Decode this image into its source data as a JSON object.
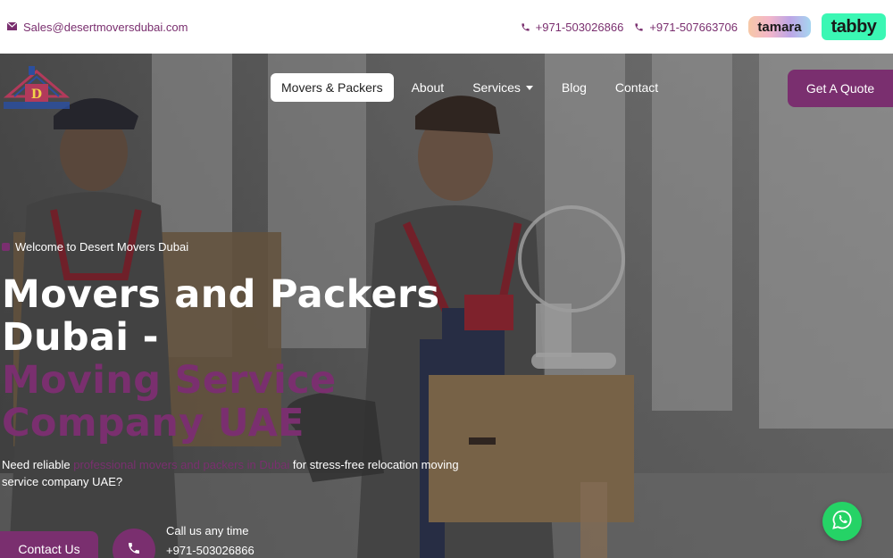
{
  "topbar": {
    "email": "Sales@desertmoversdubai.com",
    "phone1": "+971-503026866",
    "phone2": "+971-507663706",
    "tamara_label": "tamara",
    "tabby_label": "tabby"
  },
  "nav": {
    "items": [
      "Movers & Packers",
      "About",
      "Services",
      "Blog",
      "Contact"
    ],
    "quote_label": "Get A Quote"
  },
  "hero": {
    "welcome": "Welcome to Desert Movers Dubai",
    "title_line1": "Movers and Packers",
    "title_line2": "Dubai -",
    "title_line3": "Moving Service",
    "title_line4": "Company UAE",
    "desc_prefix": "Need reliable ",
    "desc_link": "professional movers and packers in Dubai",
    "desc_suffix": " for stress-free relocation moving service company UAE?",
    "contact_button": "Contact Us",
    "call_label": "Call us any time",
    "call_number": "+971-503026866"
  },
  "colors": {
    "accent": "#7a2f6f",
    "whatsapp": "#25d366",
    "tabby": "#3bf7b4"
  }
}
